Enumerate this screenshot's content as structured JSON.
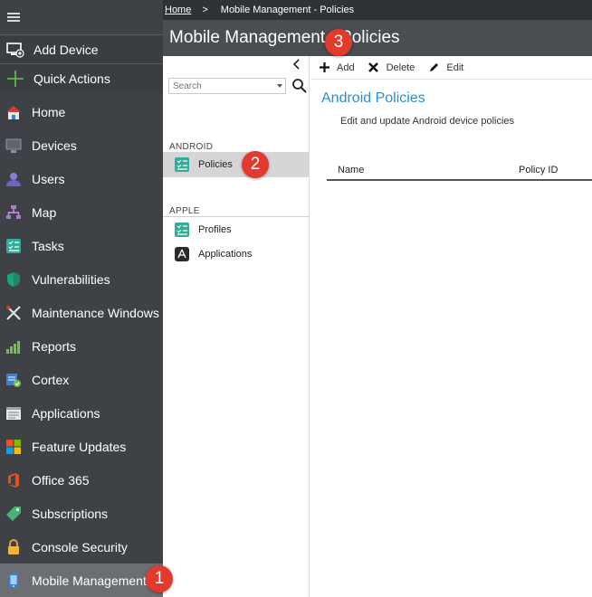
{
  "breadcrumb": {
    "home": "Home",
    "separator": ">",
    "current": "Mobile Management - Policies"
  },
  "header": {
    "title": "Mobile Management - Policies"
  },
  "nav": {
    "actions": [
      {
        "label": "Add Device",
        "icon": "add-device-icon"
      },
      {
        "label": "Quick Actions",
        "icon": "plus-icon"
      }
    ],
    "items": [
      {
        "label": "Home",
        "icon": "home-icon"
      },
      {
        "label": "Devices",
        "icon": "monitor-icon"
      },
      {
        "label": "Users",
        "icon": "users-icon"
      },
      {
        "label": "Map",
        "icon": "map-icon"
      },
      {
        "label": "Tasks",
        "icon": "tasks-icon"
      },
      {
        "label": "Vulnerabilities",
        "icon": "shield-icon"
      },
      {
        "label": "Maintenance Windows",
        "icon": "tools-icon"
      },
      {
        "label": "Reports",
        "icon": "chart-icon"
      },
      {
        "label": "Cortex",
        "icon": "cortex-icon"
      },
      {
        "label": "Applications",
        "icon": "applications-icon"
      },
      {
        "label": "Feature Updates",
        "icon": "windows-icon"
      },
      {
        "label": "Office 365",
        "icon": "office-icon"
      },
      {
        "label": "Subscriptions",
        "icon": "tag-icon"
      },
      {
        "label": "Console Security",
        "icon": "lock-icon"
      },
      {
        "label": "Mobile Management",
        "icon": "mobile-icon",
        "active": true
      }
    ]
  },
  "subnav": {
    "search_placeholder": "Search",
    "sections": [
      {
        "label": "ANDROID",
        "items": [
          {
            "label": "Policies",
            "icon": "checklist-icon",
            "active": true
          }
        ]
      },
      {
        "label": "APPLE",
        "items": [
          {
            "label": "Profiles",
            "icon": "checklist-icon"
          },
          {
            "label": "Applications",
            "icon": "app-store-icon"
          }
        ]
      }
    ]
  },
  "toolbar": {
    "add": "Add",
    "delete": "Delete",
    "edit": "Edit"
  },
  "main": {
    "title": "Android Policies",
    "subtitle": "Edit and update Android device policies",
    "columns": [
      "Name",
      "Policy ID"
    ]
  },
  "badges": [
    "1",
    "2",
    "3"
  ],
  "colors": {
    "nav_bg": "#3e4247",
    "title_bar": "#4a4e53",
    "accent": "#2a8fd6",
    "badge": "#e33a2e",
    "active_item": "#6b6f74"
  }
}
